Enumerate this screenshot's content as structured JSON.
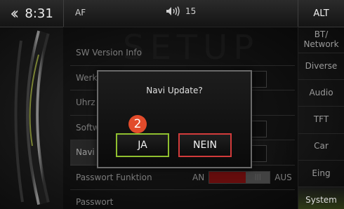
{
  "statusbar": {
    "time": "8:31",
    "source": "AF",
    "volume": "15",
    "alt_label": "ALT"
  },
  "background": {
    "watermark": "SETUP"
  },
  "menu": {
    "items": [
      {
        "label": "SW Version Info"
      },
      {
        "label": "Werk"
      },
      {
        "label": "Uhrz"
      },
      {
        "label": "Softw"
      },
      {
        "label": "Navi"
      },
      {
        "label": "Passwort Funktion"
      },
      {
        "label": "Passwort"
      }
    ],
    "toggle": {
      "on_label": "AN",
      "off_label": "AUS"
    }
  },
  "sidebar": {
    "tabs": [
      {
        "label": "BT/ Network"
      },
      {
        "label": "Diverse"
      },
      {
        "label": "Audio"
      },
      {
        "label": "TFT"
      },
      {
        "label": "Car"
      },
      {
        "label": "Eing"
      },
      {
        "label": "System"
      }
    ],
    "selected": "System"
  },
  "dialog": {
    "title": "Navi Update?",
    "confirm_label": "JA",
    "cancel_label": "NEIN",
    "marker": "2"
  },
  "colors": {
    "confirm_border": "#8fbf2f",
    "cancel_border": "#d23b3b",
    "marker": "#e24b2b",
    "toggle_on": "#9b1414"
  }
}
